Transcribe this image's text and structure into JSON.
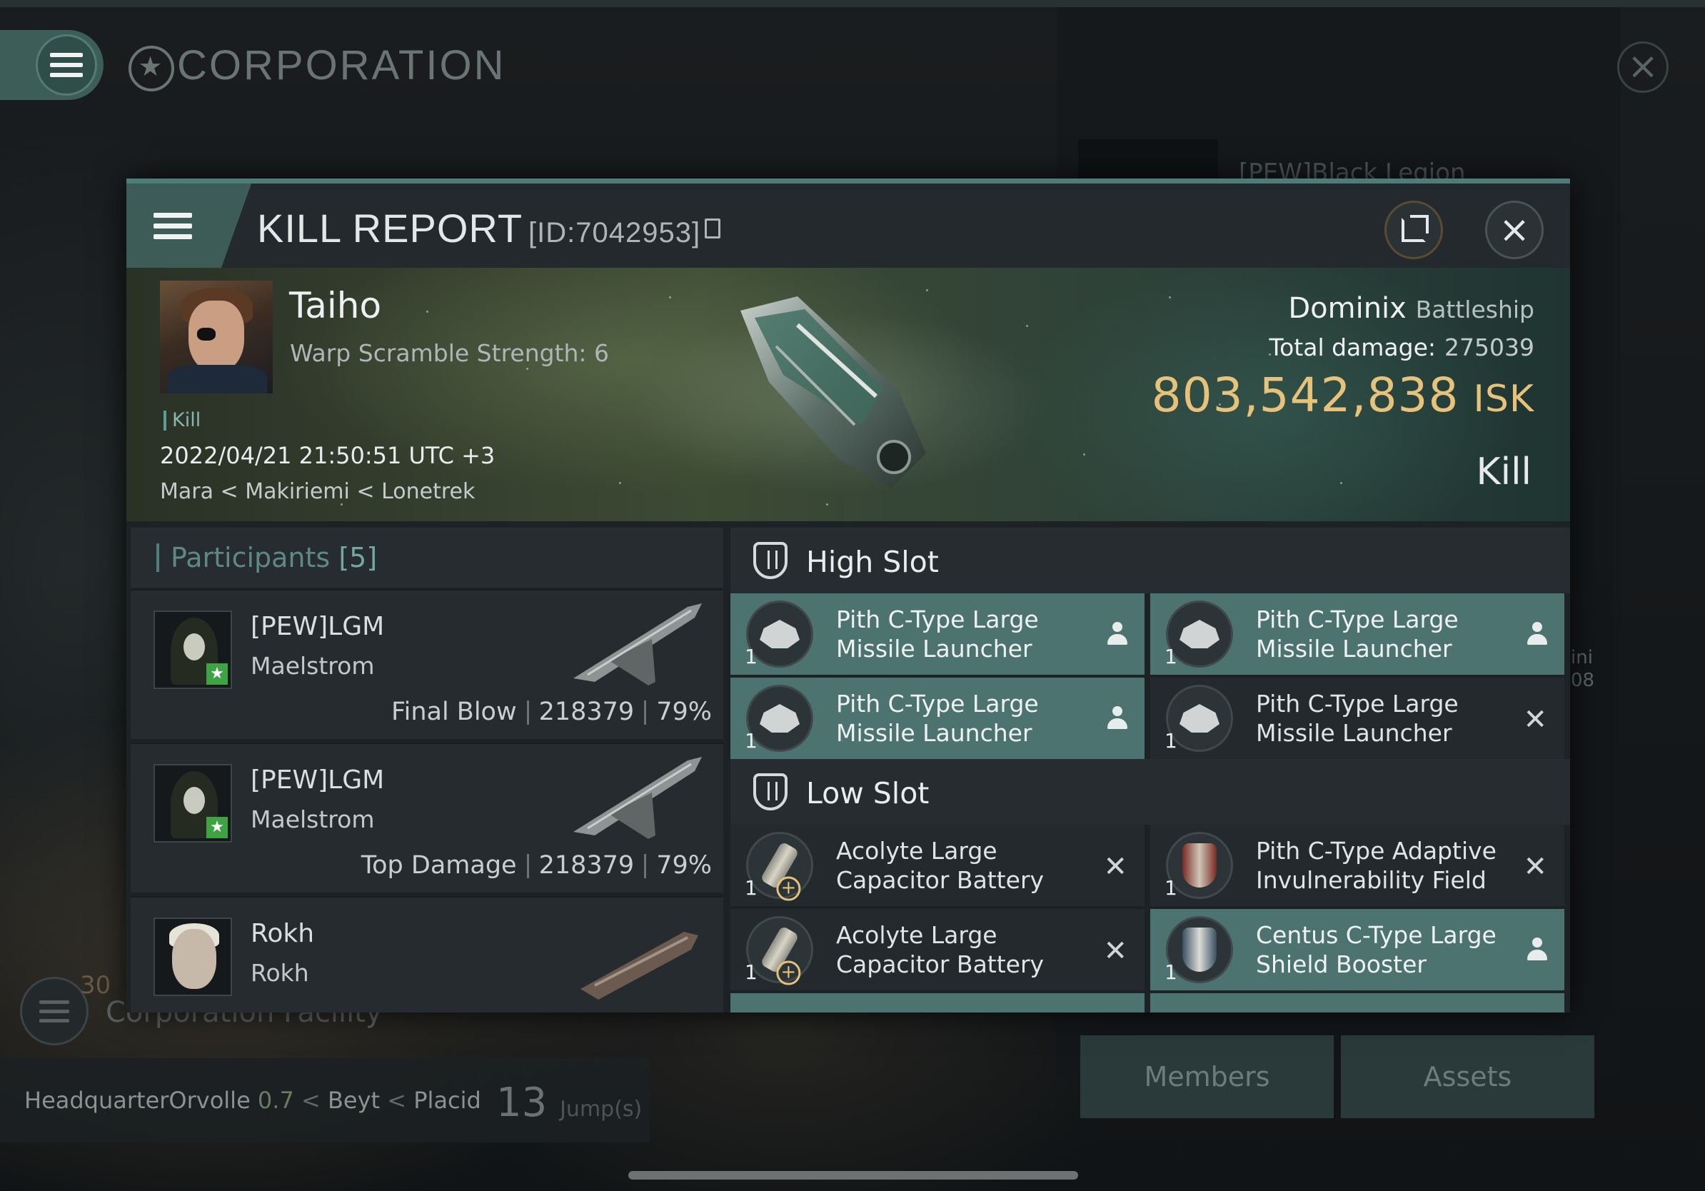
{
  "background": {
    "title": "CORPORATION",
    "alliance_name": "[PEW]Black Legion",
    "side_text": [
      "ini",
      "08"
    ],
    "facility_count": "30",
    "facility_label": "Corporation Facility",
    "hq_label": "Headquarter",
    "hq_system": "Orvolle",
    "hq_security": "0.7",
    "hq_constellation": "Beyt",
    "hq_region": "Placid",
    "jumps_value": "13",
    "jumps_unit": "Jump(s)",
    "members_label": "Members",
    "assets_label": "Assets"
  },
  "modal": {
    "title": "KILL REPORT",
    "report_id": "[ID:7042953]",
    "victim": {
      "name": "Taiho",
      "subtitle": "Warp Scramble Strength: 6",
      "tag": "Kill",
      "timestamp": "2022/04/21 21:50:51 UTC +3",
      "location": "Mara < Makiriemi < Lonetrek"
    },
    "ship": {
      "name": "Dominix",
      "class": "Battleship",
      "total_damage_label": "Total damage:",
      "total_damage_value": "275039",
      "isk_value": "803,542,838",
      "isk_unit": "ISK",
      "result": "Kill"
    },
    "participants": {
      "label": "Participants",
      "count": "[5]",
      "rows": [
        {
          "name": "[PEW]LGM",
          "ship": "Maelstrom",
          "role": "Final Blow",
          "damage": "218379",
          "percent": "79%"
        },
        {
          "name": "[PEW]LGM",
          "ship": "Maelstrom",
          "role": "Top Damage",
          "damage": "218379",
          "percent": "79%"
        },
        {
          "name": "Rokh",
          "ship": "Rokh",
          "role": "",
          "damage": "",
          "percent": ""
        }
      ]
    },
    "high_slot": {
      "label": "High Slot",
      "items": [
        {
          "qty": "1",
          "name": "Pith C-Type Large Missile Launcher",
          "state": "person"
        },
        {
          "qty": "1",
          "name": "Pith C-Type Large Missile Launcher",
          "state": "person"
        },
        {
          "qty": "1",
          "name": "Pith C-Type Large Missile Launcher",
          "state": "person"
        },
        {
          "qty": "1",
          "name": "Pith C-Type Large Missile Launcher",
          "state": "destroyed"
        }
      ]
    },
    "low_slot": {
      "label": "Low Slot",
      "items": [
        {
          "qty": "1",
          "name": "Acolyte Large Capacitor Battery",
          "state": "destroyed"
        },
        {
          "qty": "1",
          "name": "Pith C-Type Adaptive Invulnerability Field",
          "state": "destroyed"
        },
        {
          "qty": "1",
          "name": "Acolyte Large Capacitor Battery",
          "state": "destroyed"
        },
        {
          "qty": "1",
          "name": "Centus C-Type Large Shield Booster",
          "state": "person"
        }
      ]
    },
    "colors": {
      "accent": "#4e7c78",
      "highlight": "#4d7370",
      "isk": "#e6c27a"
    }
  }
}
